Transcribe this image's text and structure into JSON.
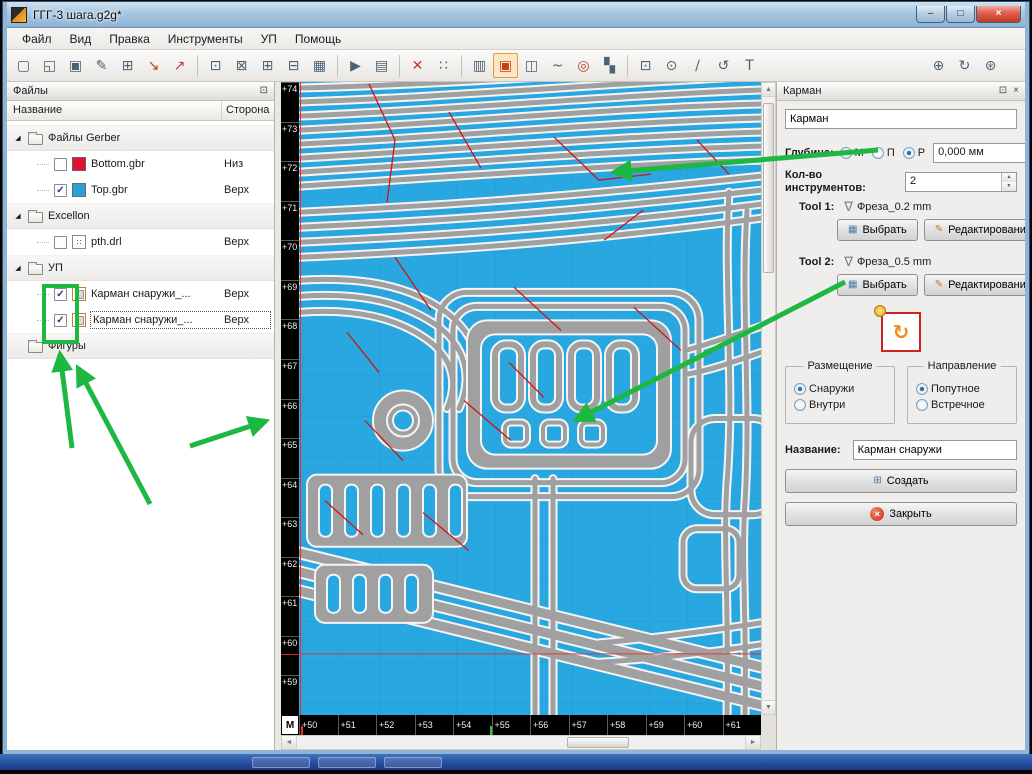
{
  "titlebar": {
    "title": "ГГГ-3 шага.g2g*",
    "minimize": "–",
    "maximize": "□",
    "close": "×"
  },
  "menu": {
    "items": [
      {
        "name": "menu-file",
        "label": "Файл"
      },
      {
        "name": "menu-view",
        "label": "Вид"
      },
      {
        "name": "menu-edit",
        "label": "Правка"
      },
      {
        "name": "menu-tools",
        "label": "Инструменты"
      },
      {
        "name": "menu-up",
        "label": "УП"
      },
      {
        "name": "menu-help",
        "label": "Помощь"
      }
    ]
  },
  "toolbar": {
    "g1": [
      {
        "name": "new-file-icon",
        "glyph": "▢"
      },
      {
        "name": "open-folder-icon",
        "glyph": "◱"
      },
      {
        "name": "save-icon",
        "glyph": "▣"
      },
      {
        "name": "save-as-icon",
        "glyph": "✎"
      },
      {
        "name": "save-all-icon",
        "glyph": "⊞"
      },
      {
        "name": "import-icon",
        "glyph": "↘",
        "tone": "red"
      },
      {
        "name": "export-icon",
        "glyph": "↗",
        "tone": "red"
      }
    ],
    "g2": [
      {
        "name": "select-frame-icon",
        "glyph": "⊡"
      },
      {
        "name": "crop-region-icon",
        "glyph": "⊠"
      },
      {
        "name": "zoom-region-icon",
        "glyph": "⊞"
      },
      {
        "name": "shrink-region-icon",
        "glyph": "⊟"
      },
      {
        "name": "tile-view-icon",
        "glyph": "▦"
      }
    ],
    "g3": [
      {
        "name": "run-icon",
        "glyph": "▶"
      },
      {
        "name": "report-icon",
        "glyph": "▤"
      }
    ],
    "g4": [
      {
        "name": "transform-icon",
        "glyph": "✕",
        "tone": "red"
      },
      {
        "name": "drill-grid-icon",
        "glyph": "∷"
      }
    ],
    "g5": [
      {
        "name": "copper-layer-icon",
        "glyph": "▥"
      },
      {
        "name": "pocket-view-icon",
        "glyph": "▣",
        "state": "active"
      },
      {
        "name": "layers-icon",
        "glyph": "◫"
      },
      {
        "name": "curve-icon",
        "glyph": "~"
      },
      {
        "name": "target-icon",
        "glyph": "◎",
        "tone": "red"
      },
      {
        "name": "hatch-icon",
        "glyph": "▚"
      }
    ],
    "g6": [
      {
        "name": "point-grid-icon",
        "glyph": "⊡"
      },
      {
        "name": "circle-tool-icon",
        "glyph": "⊙"
      },
      {
        "name": "line-tool-icon",
        "glyph": "∕"
      },
      {
        "name": "arc-tool-icon",
        "glyph": "↺"
      },
      {
        "name": "text-tool-icon",
        "glyph": "T"
      }
    ],
    "g7": [
      {
        "name": "op-copy-icon",
        "glyph": "⊕"
      },
      {
        "name": "op-rotate-icon",
        "glyph": "↻"
      },
      {
        "name": "op-mirror-icon",
        "glyph": "⊛"
      }
    ]
  },
  "icons": {
    "expander": "◢",
    "dock_float": "⊡",
    "panel_close": "×",
    "drill_file": "∷",
    "cutter": "∇",
    "spin_up": "▲",
    "spin_down": "▼",
    "scroll_up": "▲",
    "scroll_down": "▼",
    "scroll_left": "◄",
    "scroll_right": "►",
    "select_btn": "▦",
    "edit_btn": "✎",
    "create_btn": "⊞",
    "close_x": "×",
    "direction": "↻"
  },
  "files_panel": {
    "title": "Файлы",
    "columns": [
      "Название",
      "Сторона"
    ],
    "rows": [
      {
        "label": "Файлы Gerber"
      },
      {
        "label": "Bottom.gbr",
        "side": "Низ",
        "check": ""
      },
      {
        "label": "Top.gbr",
        "side": "Верх",
        "check": "✓"
      },
      {
        "label": "Excellon"
      },
      {
        "label": "pth.drl",
        "side": "Верх",
        "check": ""
      },
      {
        "label": "УП"
      },
      {
        "label": "Карман снаружи_...",
        "side": "Верх",
        "check": "✓"
      },
      {
        "label": "Карман снаружи_...",
        "side": "Верх",
        "check": "✓"
      },
      {
        "label": "Фигуры"
      }
    ]
  },
  "canvas": {
    "unit": "M",
    "v_ruler": [
      "+74",
      "+73",
      "+72",
      "+71",
      "+70",
      "+69",
      "+68",
      "+67",
      "+66",
      "+65",
      "+64",
      "+63",
      "+62",
      "+61",
      "+60",
      "+59"
    ],
    "h_ruler": [
      "+50",
      "+51",
      "+52",
      "+53",
      "+54",
      "+55",
      "+56",
      "+57",
      "+58",
      "+59",
      "+60",
      "+61"
    ]
  },
  "pocket_panel": {
    "title": "Карман",
    "name_input": "Карман",
    "depth_label": "Глубина:",
    "depth_options": [
      "М",
      "П",
      "Р"
    ],
    "depth_selected": "Р",
    "depth_value": "0,000 мм",
    "tools_label": "Кол-во инструментов:",
    "tools_value": "2",
    "tool1_label": "Tool 1:",
    "tool1_value": "Фреза_0.2 mm",
    "tool2_label": "Tool 2:",
    "tool2_value": "Фреза_0.5 mm",
    "select_button": "Выбрать",
    "edit_button": "Редактировани",
    "placement": {
      "title": "Размещение",
      "options": [
        "Снаружи",
        "Внутри"
      ],
      "selected": "Снаружи"
    },
    "direction": {
      "title": "Направление",
      "options": [
        "Попутное",
        "Встречное"
      ],
      "selected": "Попутное"
    },
    "name_label": "Название:",
    "name_value": "Карман снаружи",
    "create_button": "Создать",
    "close_button": "Закрыть"
  }
}
